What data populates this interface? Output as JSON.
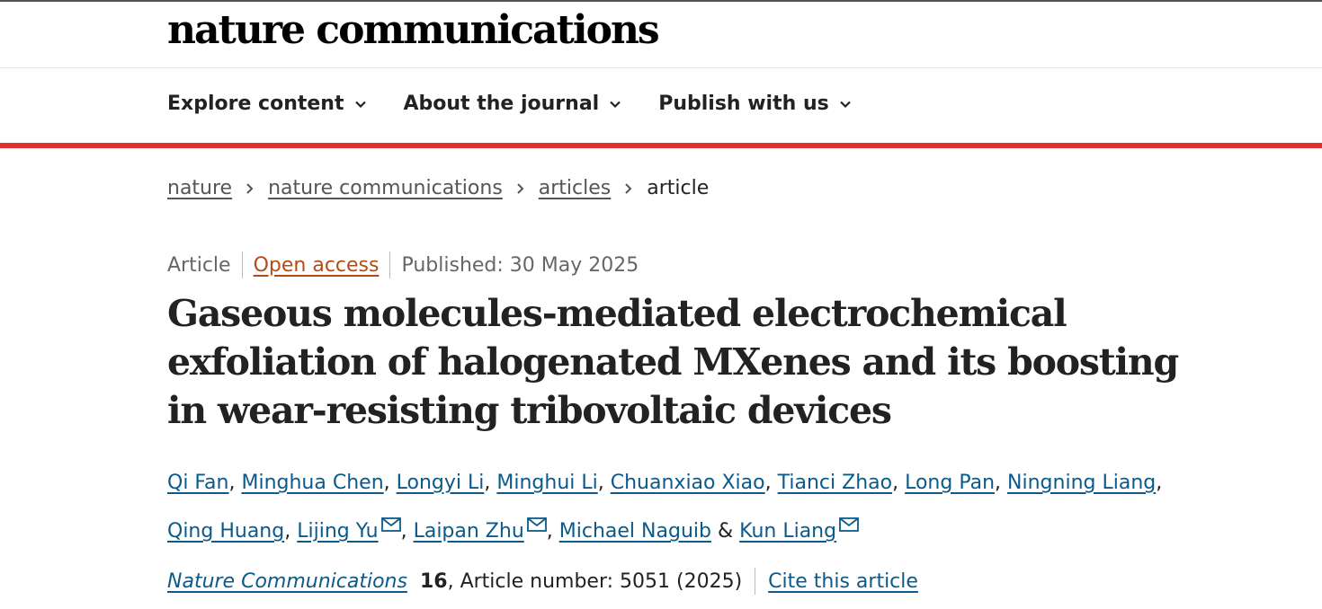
{
  "site": {
    "logo": "nature communications"
  },
  "nav": {
    "items": [
      {
        "label": "Explore content"
      },
      {
        "label": "About the journal"
      },
      {
        "label": "Publish with us"
      }
    ]
  },
  "breadcrumb": {
    "items": [
      {
        "label": "nature"
      },
      {
        "label": "nature communications"
      },
      {
        "label": "articles"
      }
    ],
    "current": "article"
  },
  "article": {
    "type": "Article",
    "access": "Open access",
    "published": "Published: 30 May 2025",
    "title": "Gaseous molecules-mediated electrochemical exfoliation of halogenated MXenes and its boosting in wear-resisting tribovoltaic devices",
    "authors": [
      {
        "name": "Qi Fan",
        "mail": false
      },
      {
        "name": "Minghua Chen",
        "mail": false
      },
      {
        "name": "Longyi Li",
        "mail": false
      },
      {
        "name": "Minghui Li",
        "mail": false
      },
      {
        "name": "Chuanxiao Xiao",
        "mail": false
      },
      {
        "name": "Tianci Zhao",
        "mail": false
      },
      {
        "name": "Long Pan",
        "mail": false
      },
      {
        "name": "Ningning Liang",
        "mail": false
      },
      {
        "name": "Qing Huang",
        "mail": false
      },
      {
        "name": "Lijing Yu",
        "mail": true
      },
      {
        "name": "Laipan Zhu",
        "mail": true
      },
      {
        "name": "Michael Naguib",
        "mail": false
      },
      {
        "name": "Kun Liang",
        "mail": true
      }
    ],
    "citation": {
      "journal": "Nature Communications",
      "volume": "16",
      "article_number": ", Article number: 5051 (2025)",
      "cite_label": "Cite this article"
    }
  },
  "colors": {
    "accent_red": "#e0312e",
    "link_blue": "#0b5a8a",
    "open_access": "#b34c13"
  }
}
